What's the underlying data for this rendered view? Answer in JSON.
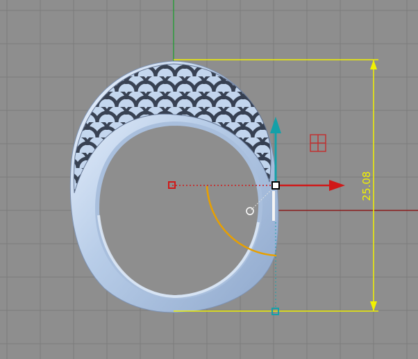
{
  "viewport": {
    "background_color": "#8e8e8e",
    "grid_color": "#7c7c7c",
    "axis_x_color": "#8a1d1d",
    "axis_y_color": "#2d9a3d"
  },
  "dimension": {
    "value_label": "25.08",
    "color": "#f2f200"
  },
  "gizmo": {
    "move_x_color": "#d01818",
    "move_y_color": "#14a0a8",
    "rotate_color": "#e8a000",
    "pivot_color": "#ffffff"
  },
  "model": {
    "name": "ring",
    "color": "#b9cfea"
  }
}
